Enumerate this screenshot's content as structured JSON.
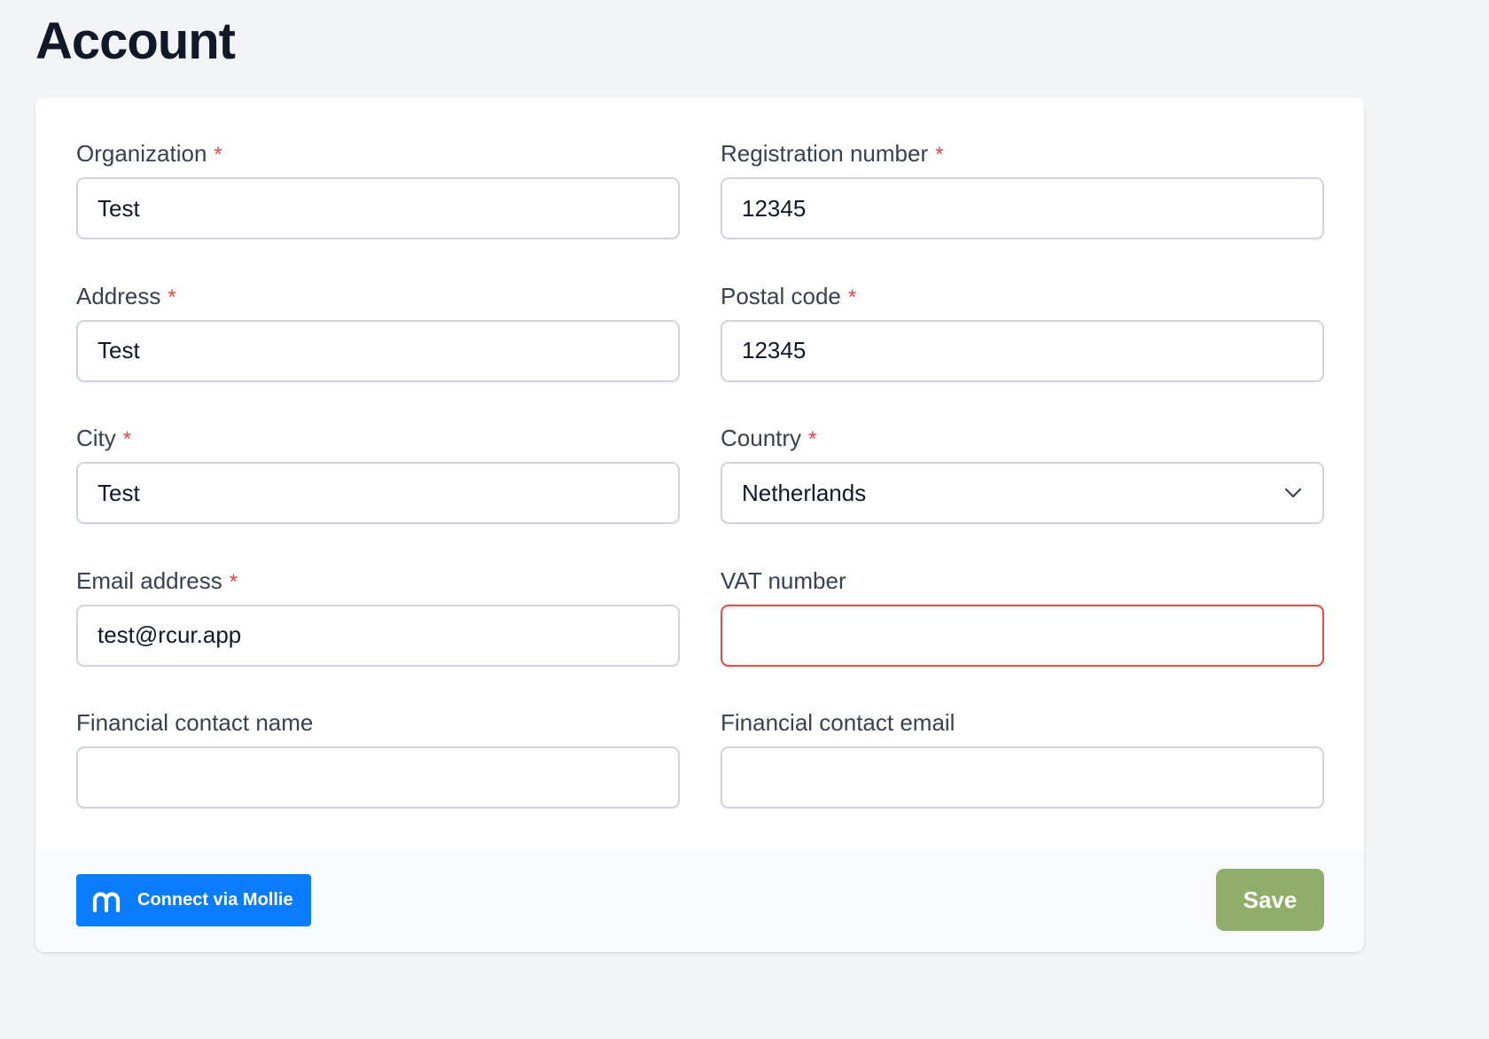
{
  "page": {
    "title": "Account"
  },
  "form": {
    "fields": [
      {
        "label": "Organization",
        "required": "*",
        "value": "Test"
      },
      {
        "label": "Registration number",
        "required": "*",
        "value": "12345"
      },
      {
        "label": "Address",
        "required": "*",
        "value": "Test"
      },
      {
        "label": "Postal code",
        "required": "*",
        "value": "12345"
      },
      {
        "label": "City",
        "required": "*",
        "value": "Test"
      },
      {
        "label": "Country",
        "required": "*",
        "value": "Netherlands"
      },
      {
        "label": "Email address",
        "required": "*",
        "value": "test@rcur.app"
      },
      {
        "label": "VAT number",
        "value": "",
        "state": "error"
      },
      {
        "label": "Financial contact name",
        "value": ""
      },
      {
        "label": "Financial contact email",
        "value": ""
      }
    ]
  },
  "footer": {
    "mollie_label": "Connect via Mollie",
    "save_label": "Save"
  },
  "colors": {
    "required": "#ef4444",
    "error_border": "#ef4444",
    "mollie": "#0a7cff",
    "save": "#8fae6a"
  },
  "icons": {
    "country_select": "chevron-down-icon",
    "mollie": "mollie-logo-icon"
  }
}
